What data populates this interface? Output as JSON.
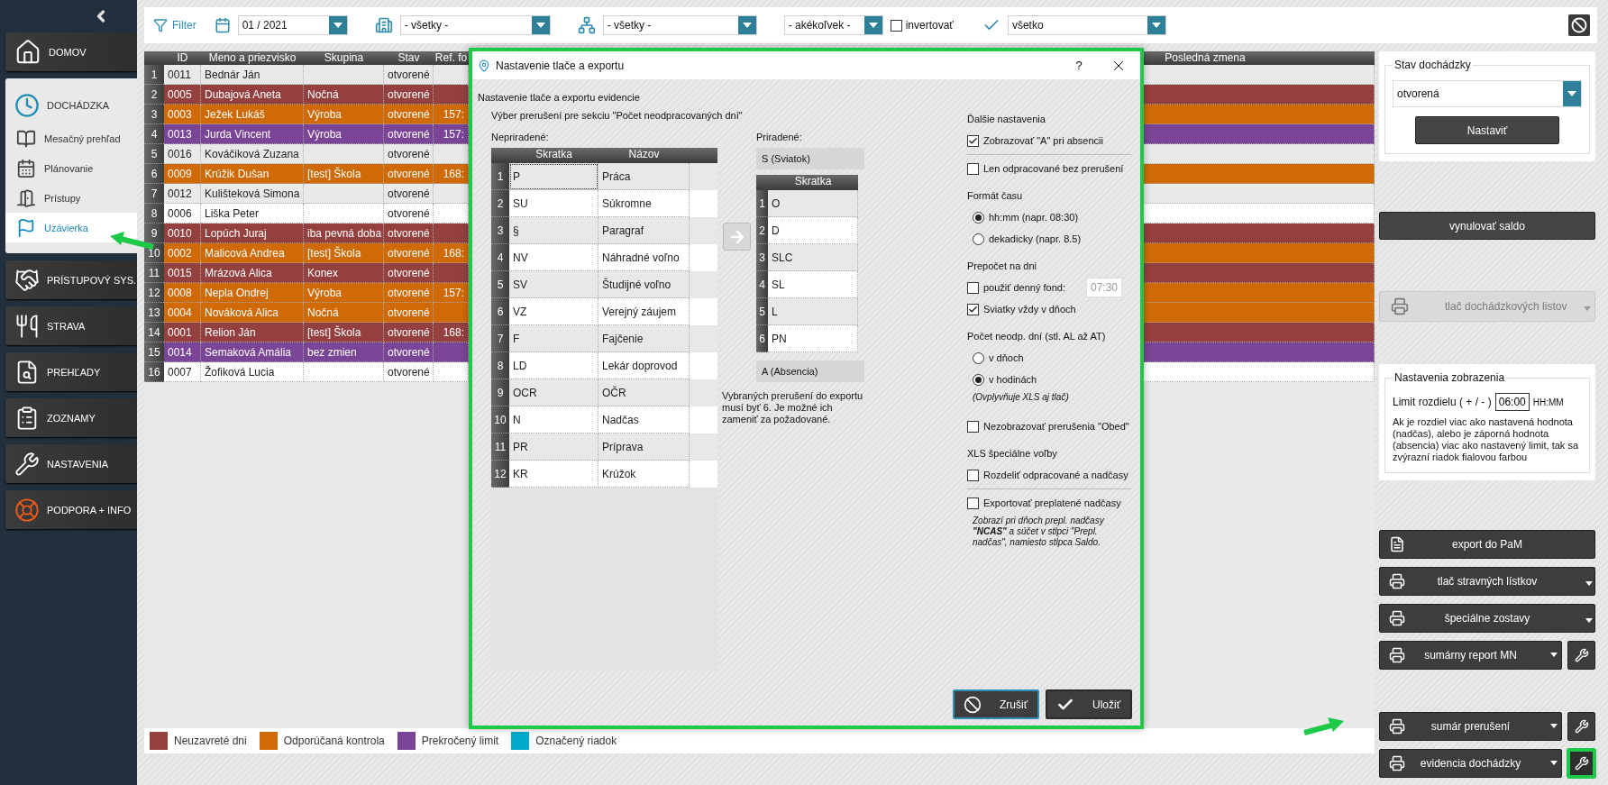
{
  "sidebar": {
    "top_tiles": [
      {
        "label": "DOMOV"
      }
    ],
    "group": {
      "label": "DOCHÁDZKA",
      "items": [
        {
          "label": "Mesačný prehľad",
          "selected": false
        },
        {
          "label": "Plánovanie",
          "selected": false
        },
        {
          "label": "Prístupy",
          "selected": false
        },
        {
          "label": "Uzávierka",
          "selected": true
        }
      ]
    },
    "tiles": [
      {
        "label": "PRÍSTUPOVÝ SYS."
      },
      {
        "label": "STRAVA"
      },
      {
        "label": "PREHĽADY"
      },
      {
        "label": "ZOZNAMY"
      },
      {
        "label": "NASTAVENIA"
      },
      {
        "label": "PODPORA + INFO"
      }
    ]
  },
  "toolbar": {
    "filter_label": "Filter",
    "period": "01 / 2021",
    "building": "- všetky -",
    "group": "- všetky -",
    "kind": "- akékoľvek -",
    "invert": {
      "label": "invertovať",
      "checked": false
    },
    "status": "všetko"
  },
  "table": {
    "columns": [
      "ID",
      "Meno a priezvisko",
      "Skupina",
      "Stav",
      "Ref. fo",
      "Posledná zmena"
    ],
    "rows": [
      {
        "num": "1",
        "id": "0011",
        "name": "Bednár Ján",
        "state": "otvorené"
      },
      {
        "num": "2",
        "id": "0005",
        "name": "Dubajová Aneta",
        "group": "Nočná",
        "state": "otvorené",
        "color": "#94403f"
      },
      {
        "num": "3",
        "id": "0003",
        "name": "Ježek Lukáš",
        "group": "Výroba",
        "state": "otvorené",
        "ref": "157:",
        "color": "#d06a06"
      },
      {
        "num": "4",
        "id": "0013",
        "name": "Jurda Vincent",
        "group": "Výroba",
        "state": "otvorené",
        "ref": "157:",
        "color": "#7a4596"
      },
      {
        "num": "5",
        "id": "0016",
        "name": "Kováčiková Zuzana",
        "state": "otvorené"
      },
      {
        "num": "6",
        "id": "0009",
        "name": "Krúžik Dušan",
        "group": "[test] Škola",
        "state": "otvorené",
        "ref": "168:",
        "color": "#d06a06"
      },
      {
        "num": "7",
        "id": "0012",
        "name": "Kulišteková Simona",
        "state": "otvorené"
      },
      {
        "num": "8",
        "id": "0006",
        "name": "Liška Peter",
        "state": "otvorené"
      },
      {
        "num": "9",
        "id": "0010",
        "name": "Lopúch Juraj",
        "group": "iba pevná doba",
        "state": "otvorené",
        "color": "#94403f"
      },
      {
        "num": "10",
        "id": "0002",
        "name": "Malicová Andrea",
        "group": "[test] Škola",
        "state": "otvorené",
        "ref": "168:",
        "color": "#d06a06"
      },
      {
        "num": "11",
        "id": "0015",
        "name": "Mrázová Alica",
        "group": "Konex",
        "state": "otvorené",
        "color": "#94403f"
      },
      {
        "num": "12",
        "id": "0008",
        "name": "Nepla Ondrej",
        "group": "Výroba",
        "state": "otvorené",
        "ref": "157:",
        "color": "#d06a06"
      },
      {
        "num": "13",
        "id": "0004",
        "name": "Nováková Alica",
        "group": "Nočná",
        "state": "otvorené",
        "color": "#d06a06"
      },
      {
        "num": "14",
        "id": "0001",
        "name": "Relion Ján",
        "group": "[test] Škola",
        "state": "otvorené",
        "ref": "168:",
        "color": "#94403f"
      },
      {
        "num": "15",
        "id": "0014",
        "name": "Semaková Amália",
        "group": "bez zmien",
        "state": "otvorené",
        "color": "#7a4596"
      },
      {
        "num": "16",
        "id": "0007",
        "name": "Žofiková Lucia",
        "state": "otvorené"
      }
    ]
  },
  "legend": [
    {
      "label": "Neuzavreté dni",
      "color": "#94403f"
    },
    {
      "label": "Odporúčaná kontrola",
      "color": "#d06a06"
    },
    {
      "label": "Prekročený limit",
      "color": "#7a4596"
    },
    {
      "label": "Označený riadok",
      "color": "#00aacc"
    }
  ],
  "right_panel": {
    "status_box": {
      "legend": "Stav dochádzky",
      "value": "otvorená",
      "button": "Nastaviť"
    },
    "reset_button": "vynulovať saldo",
    "print_sheets": {
      "label": "tlač dochádzkových listov",
      "disabled": true
    },
    "display_box": {
      "legend": "Nastavenia zobrazenia",
      "limit_label": "Limit rozdielu ( + / - )",
      "limit_value": "06:00",
      "unit": "HH:MM",
      "description": "Ak je rozdiel viac ako nastavená hodnota (nadčas), alebo je záporná hodnota (absencia) viac ako nastavený limit, tak sa zvýrazní riadok fialovou farbou"
    },
    "actions": [
      {
        "label": "export do PaM",
        "kind": "export"
      },
      {
        "label": "tlač stravných lístkov",
        "kind": "menu"
      },
      {
        "label": "špeciálne zostavy",
        "kind": "menu"
      },
      {
        "label": "sumárny report MN",
        "kind": "split",
        "highlighted": false
      },
      {
        "label": "sumár prerušení",
        "kind": "split",
        "highlighted": false
      },
      {
        "label": "evidencia dochádzky",
        "kind": "split",
        "highlighted": true
      }
    ]
  },
  "dialog": {
    "title": "Nastavenie tlače a exportu",
    "help": "?",
    "heading": "Nastavenie tlače a exportu evidencie",
    "section": "Výber prerušení pre sekciu \"Počet neodpracovaných dní\"",
    "unassigned": {
      "label": "Nepriradené:",
      "columns": [
        "Skratka",
        "Názov"
      ],
      "rows": [
        {
          "num": "1",
          "code": "P",
          "name": "Práca",
          "selected": true
        },
        {
          "num": "2",
          "code": "SU",
          "name": "Súkromne",
          "selected": false
        },
        {
          "num": "3",
          "code": "§",
          "name": "Paragraf",
          "selected": false
        },
        {
          "num": "4",
          "code": "NV",
          "name": "Náhradné voľno",
          "selected": false
        },
        {
          "num": "5",
          "code": "SV",
          "name": "Študijné voľno",
          "selected": false
        },
        {
          "num": "6",
          "code": "VZ",
          "name": "Verejný záujem",
          "selected": false
        },
        {
          "num": "7",
          "code": "F",
          "name": "Fajčenie",
          "selected": false
        },
        {
          "num": "8",
          "code": "LD",
          "name": "Lekár doprovod",
          "selected": false
        },
        {
          "num": "9",
          "code": "OCR",
          "name": "OČR",
          "selected": false
        },
        {
          "num": "10",
          "code": "N",
          "name": "Nadčas",
          "selected": false
        },
        {
          "num": "11",
          "code": "PR",
          "name": "Príprava",
          "selected": false
        },
        {
          "num": "12",
          "code": "KR",
          "name": "Krúžok",
          "selected": false
        }
      ]
    },
    "assigned": {
      "label": "Priradené:",
      "top": "S (Sviatok)",
      "column": "Skratka",
      "rows": [
        {
          "num": "1",
          "code": "O"
        },
        {
          "num": "2",
          "code": "D"
        },
        {
          "num": "3",
          "code": "SLC"
        },
        {
          "num": "4",
          "code": "SL"
        },
        {
          "num": "5",
          "code": "L"
        },
        {
          "num": "6",
          "code": "PN"
        }
      ],
      "bottom": "A (Absencia)"
    },
    "note": "Vybraných prerušení do exportu musí byť 6. Je možné ich zameniť za požadované.",
    "options": [
      {
        "kind": "heading",
        "label": "Ďalšie nastavenia"
      },
      {
        "kind": "checkbox",
        "label": "Zobrazovať \"A\" pri absencii",
        "checked": true
      },
      {
        "kind": "rule"
      },
      {
        "kind": "checkbox",
        "label": "Len odpracované bez prerušení",
        "checked": false
      },
      {
        "kind": "heading",
        "label": "Formát času"
      },
      {
        "kind": "radio",
        "label": "hh:mm (napr. 08:30)",
        "selected": true
      },
      {
        "kind": "radio",
        "label": "dekadicky (napr. 8.5)",
        "selected": false
      },
      {
        "kind": "heading",
        "label": "Prepočet na dni"
      },
      {
        "kind": "checkbox_input",
        "label": "použiť denný fond:",
        "checked": false,
        "value": "07:30"
      },
      {
        "kind": "checkbox",
        "label": "Sviatky vždy v dňoch",
        "checked": true
      },
      {
        "kind": "heading",
        "label": "Počet neodp. dní  (stl. AL až AT)"
      },
      {
        "kind": "radio",
        "label": "v dňoch",
        "selected": false
      },
      {
        "kind": "radio",
        "label": "v hodinách",
        "selected": true
      },
      {
        "kind": "note",
        "text": "(Ovplyvňuje XLS aj tlač)"
      },
      {
        "kind": "checkbox",
        "label": "Nezobrazovať prerušenia \"Obed\"",
        "checked": false
      },
      {
        "kind": "heading",
        "label": "XLS špeciálne voľby"
      },
      {
        "kind": "checkbox",
        "label": "Rozdeliť odpracované a nadčasy",
        "checked": false
      },
      {
        "kind": "rule"
      },
      {
        "kind": "checkbox",
        "label": "Exportovať preplatené nadčasy",
        "checked": false
      },
      {
        "kind": "note",
        "text": "Zobrazí pri dňoch prepl. nadčasy **\"NCAS\"** a súčet v stĺpci \"Prepl. nadčas\", namiesto stĺpca Saldo."
      }
    ],
    "buttons": [
      {
        "label": "Zrušiť",
        "kind": "cancel",
        "focused": true
      },
      {
        "label": "Uložiť",
        "kind": "save",
        "focused": false
      }
    ]
  }
}
